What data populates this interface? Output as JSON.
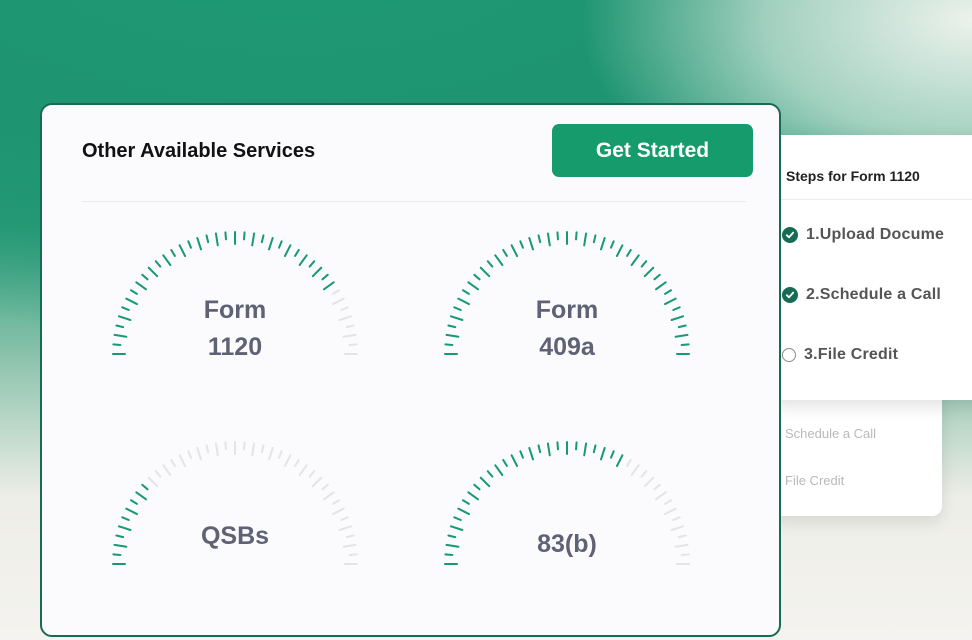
{
  "main": {
    "title": "Other Available Services",
    "cta_label": "Get Started",
    "gauges": [
      {
        "line1": "Form",
        "line2": "1120",
        "progress": 0.8
      },
      {
        "line1": "Form",
        "line2": "409a",
        "progress": 1.0
      },
      {
        "line1": "QSBs",
        "line2": "",
        "progress": 0.25
      },
      {
        "line1": "",
        "line2": "83(b)",
        "progress": 0.65
      }
    ]
  },
  "steps_panel": {
    "title": "Steps for Form 1120",
    "steps": [
      {
        "label": "1.Upload Docume",
        "done": true
      },
      {
        "label": "2.Schedule a Call",
        "done": true
      },
      {
        "label": "3.File Credit",
        "done": false
      }
    ],
    "background_items": [
      "Schedule a Call",
      "File Credit"
    ]
  },
  "colors": {
    "accent": "#159b6c",
    "accent_dark": "#176b54",
    "tick_inactive": "#e4e4e8",
    "label": "#5f6275"
  }
}
